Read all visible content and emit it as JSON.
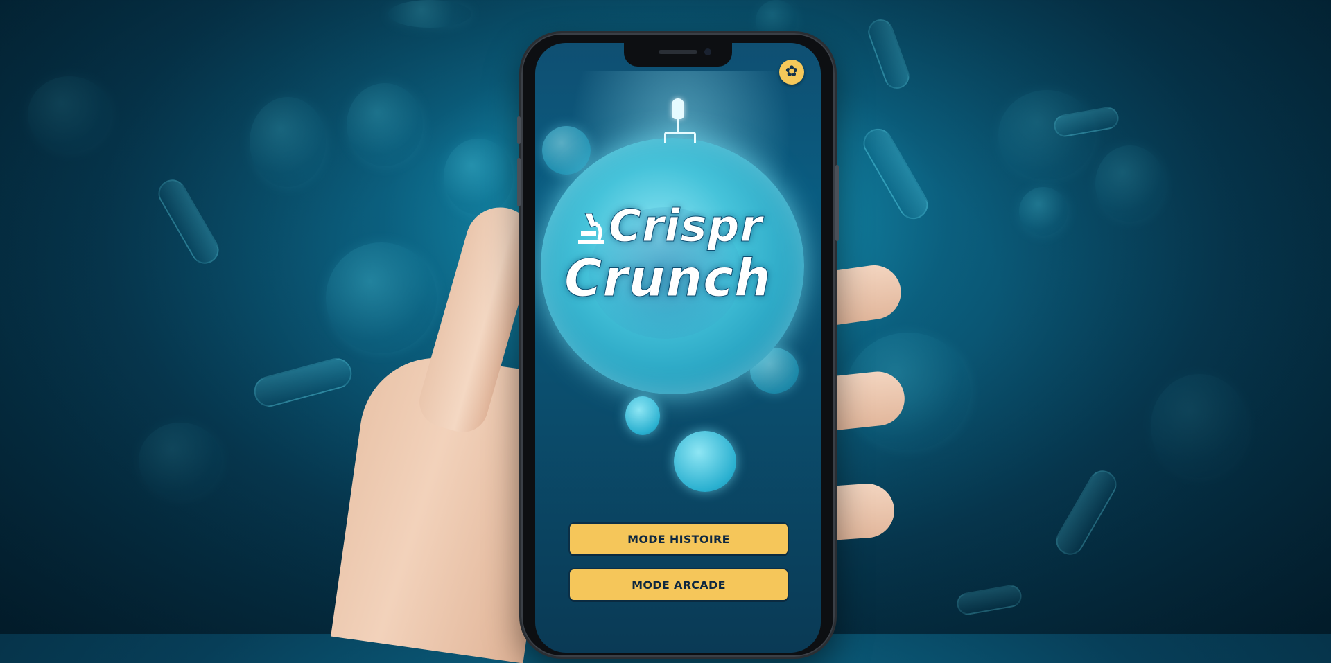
{
  "app": {
    "logo_line1": "Crispr",
    "logo_line2": "Crunch"
  },
  "header": {
    "settings_icon": "gear-icon",
    "settings_glyph": "✿"
  },
  "menu": {
    "story_mode_label": "MODE HISTOIRE",
    "arcade_mode_label": "MODE ARCADE"
  },
  "colors": {
    "button_bg": "#f5c65a",
    "button_text": "#0e2740",
    "screen_bg": "#0a5c80",
    "cell_glow": "#46c3da"
  }
}
